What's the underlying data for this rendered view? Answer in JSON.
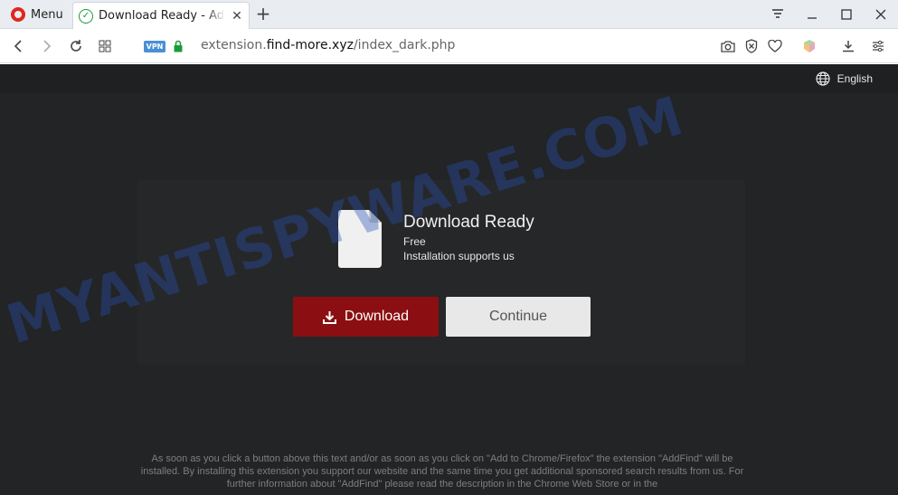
{
  "browser": {
    "menu_label": "Menu",
    "tab_title": "Download Ready - AddFind",
    "url_prefix": "extension.",
    "url_host": "find-more.xyz",
    "url_path": "/index_dark.php",
    "vpn_label": "VPN"
  },
  "page": {
    "language": "English",
    "title": "Download Ready",
    "free_label": "Free",
    "subtitle": "Installation supports us",
    "download_button": "Download",
    "continue_button": "Continue",
    "disclaimer": "As soon as you click a button above this text and/or as soon as you click on \"Add to Chrome/Firefox\" the extension \"AddFind\" will be installed. By installing this extension you support our website and the same time you get additional sponsored search results from us. For further information about \"AddFind\" please read the description in the Chrome Web Store or in the"
  },
  "watermark": "MYANTISPYWARE.COM",
  "colors": {
    "download_button": "#8b0f12",
    "continue_button": "#e8e8e8",
    "page_background": "#222425"
  }
}
